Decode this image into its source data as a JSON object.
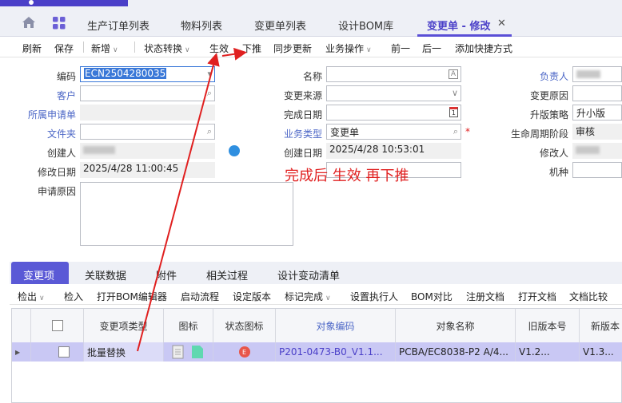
{
  "tabs": {
    "items": [
      "生产订单列表",
      "物料列表",
      "变更单列表",
      "设计BOM库",
      "变更单 - 修改"
    ],
    "close": "✕"
  },
  "toolbar": {
    "refresh": "刷新",
    "save": "保存",
    "new": "新增",
    "status": "状态转换",
    "effect": "生效",
    "push": "下推",
    "sync": "同步更新",
    "biz": "业务操作",
    "prev": "前一",
    "next": "后一",
    "shortcut": "添加快捷方式"
  },
  "form": {
    "code_label": "编码",
    "code_value": "ECN2504280035",
    "customer_label": "客户",
    "apply_label": "所属申请单",
    "folder_label": "文件夹",
    "creator_label": "创建人",
    "modify_date_label": "修改日期",
    "modify_date_value": "2025/4/28 11:00:45",
    "reason_label": "申请原因",
    "name_label": "名称",
    "source_label": "变更来源",
    "finish_date_label": "完成日期",
    "biztype_label": "业务类型",
    "biztype_value": "变更单",
    "create_date_label": "创建日期",
    "create_date_value": "2025/4/28 10:53:01",
    "owner_label": "负责人",
    "change_reason_label": "变更原因",
    "upgrade_label": "升版策略",
    "upgrade_value": "升小版",
    "lifecycle_label": "生命周期阶段",
    "lifecycle_value": "审核",
    "modifier_label": "修改人",
    "model_label": "机种",
    "required_mark": "*"
  },
  "annotation": {
    "text": "完成后 生效 再下推",
    "color": "#e02020"
  },
  "bottom_tabs": [
    "变更项",
    "关联数据",
    "附件",
    "相关过程",
    "设计变动清单"
  ],
  "subtoolbar": [
    "检出",
    "检入",
    "打开BOM编辑器",
    "启动流程",
    "设定版本",
    "标记完成",
    "设置执行人",
    "BOM对比",
    "注册文档",
    "打开文档",
    "文档比较"
  ],
  "grid": {
    "headers": [
      "变更项类型",
      "图标",
      "状态图标",
      "对象编码",
      "对象名称",
      "旧版本号",
      "新版本"
    ],
    "row": {
      "type": "批量替换",
      "status_icon": "E",
      "code": "P201-0473-B0_V1.1...",
      "name": "PCBA/EC8038-P2  A/4...",
      "old_ver": "V1.2...",
      "new_ver": "V1.3..."
    }
  },
  "colors": {
    "accent": "#5a59d6",
    "row_highlight": "#c9c8f4",
    "link": "#4b66c6",
    "annotation": "#e02020"
  }
}
